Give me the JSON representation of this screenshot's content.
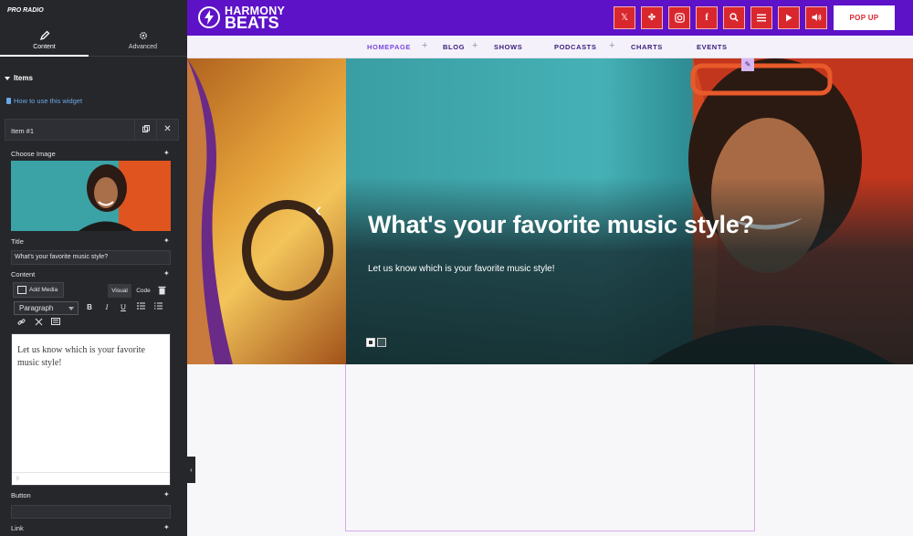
{
  "panel": {
    "logo_text": "PRO RADIO",
    "tabs": [
      {
        "label": "Content",
        "icon": "pencil-icon",
        "active": true
      },
      {
        "label": "Advanced",
        "icon": "gear-icon",
        "active": false
      }
    ],
    "section_title": "Items",
    "help_link": "How to use this widget",
    "item_name": "Item #1",
    "fields": {
      "image_label": "Choose Image",
      "title_label": "Title",
      "title_value": "What's your favorite music style?",
      "content_label": "Content",
      "add_media": "Add Media",
      "visual_tab": "Visual",
      "code_tab": "Code",
      "format_value": "Paragraph",
      "editor_text": "Let us know which is your favorite music style!",
      "editor_footer": "p",
      "button_label": "Button",
      "link_label": "Link"
    }
  },
  "site": {
    "brand_line1": "HARMONY",
    "brand_line2": "BEATS",
    "social_icons": [
      "x-icon",
      "slack-icon",
      "instagram-icon",
      "facebook-icon",
      "search-icon",
      "menu-icon",
      "play-icon",
      "volume-icon"
    ],
    "popup_label": "POP UP",
    "nav": [
      {
        "label": "HOMEPAGE",
        "has_sub": true,
        "active": true
      },
      {
        "label": "BLOG",
        "has_sub": true,
        "active": false
      },
      {
        "label": "SHOWS",
        "has_sub": false,
        "active": false
      },
      {
        "label": "PODCASTS",
        "has_sub": true,
        "active": false
      },
      {
        "label": "CHARTS",
        "has_sub": false,
        "active": false
      },
      {
        "label": "EVENTS",
        "has_sub": false,
        "active": false
      }
    ],
    "hero": {
      "title": "What's your favorite music style?",
      "subtitle": "Let us know which is your favorite music style!",
      "slides_total": 2,
      "active_slide": 1
    }
  },
  "colors": {
    "panel_bg": "#26272b",
    "topbar": "#5d12c7",
    "social_red": "#d9272e",
    "nav_text": "#3a1d7a",
    "nav_active": "#7a48d9",
    "link": "#6aa8e6"
  }
}
